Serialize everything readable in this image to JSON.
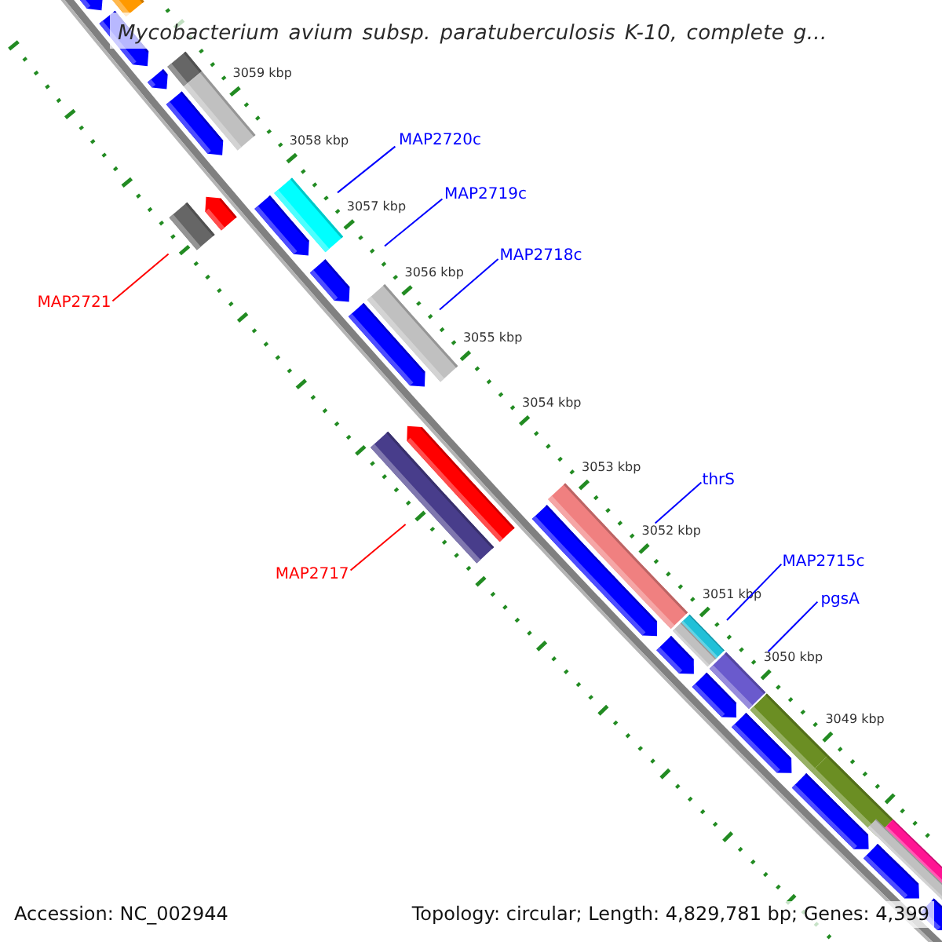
{
  "title": "Mycobacterium avium subsp. paratuberculosis K-10, complete g...",
  "ruler": {
    "tick_labels": [
      "3059 kbp",
      "3058 kbp",
      "3057 kbp",
      "3056 kbp",
      "3055 kbp",
      "3054 kbp",
      "3053 kbp",
      "3052 kbp",
      "3051 kbp",
      "3050 kbp",
      "3049 kbp"
    ]
  },
  "features": [
    {
      "kind": "arrow",
      "complement": true,
      "color": "#0000ff"
    },
    {
      "kind": "arrow",
      "complement": true,
      "color": "#0000ff"
    },
    {
      "kind": "arrow",
      "complement": true,
      "color": "#0000ff"
    },
    {
      "kind": "arrow",
      "complement": true,
      "color": "#0000ff"
    },
    {
      "kind": "arrow",
      "complement": true,
      "color": "#0000ff"
    },
    {
      "kind": "arrow",
      "complement": true,
      "color": "#0000ff"
    },
    {
      "kind": "arrow",
      "complement": true,
      "color": "#0000ff"
    },
    {
      "kind": "arrow",
      "complement": true,
      "color": "#0000ff"
    },
    {
      "kind": "arrow",
      "complement": true,
      "color": "#0000ff"
    },
    {
      "kind": "arrow",
      "complement": true,
      "color": "#0000ff"
    },
    {
      "kind": "arrow",
      "complement": true,
      "color": "#0000ff"
    },
    {
      "kind": "arrow",
      "complement": true,
      "color": "#0000ff"
    },
    {
      "kind": "arrow",
      "complement": true,
      "color": "#0000ff"
    },
    {
      "kind": "arrow",
      "complement": true,
      "color": "#0000ff"
    },
    {
      "kind": "block",
      "complement": true,
      "color": "#ff9900"
    },
    {
      "kind": "block",
      "complement": true,
      "color": "#666666"
    },
    {
      "kind": "block",
      "complement": true,
      "color": "#c0c0c0"
    },
    {
      "kind": "block",
      "complement": true,
      "color": "#00ffff"
    },
    {
      "kind": "block",
      "complement": true,
      "color": "#c0c0c0"
    },
    {
      "kind": "block",
      "complement": true,
      "color": "#f08080"
    },
    {
      "kind": "block",
      "complement": true,
      "color": "#20c0d8"
    },
    {
      "kind": "block",
      "complement": true,
      "color": "#c0c0c0"
    },
    {
      "kind": "block",
      "complement": true,
      "color": "#6a5acd"
    },
    {
      "kind": "block",
      "complement": true,
      "color": "#6b8e23"
    },
    {
      "kind": "block",
      "complement": true,
      "color": "#6b8e23"
    },
    {
      "kind": "block",
      "complement": true,
      "color": "#ff1493"
    },
    {
      "kind": "block",
      "complement": true,
      "color": "#c0c0c0"
    },
    {
      "kind": "arrow",
      "complement": false,
      "color": "#ff0000"
    },
    {
      "kind": "arrow",
      "complement": false,
      "color": "#ff0000"
    },
    {
      "kind": "block",
      "complement": false,
      "color": "#666666"
    },
    {
      "kind": "block",
      "complement": false,
      "color": "#483d8b"
    }
  ],
  "gene_labels": [
    {
      "text": "MAP2720c",
      "color": "#0000ff"
    },
    {
      "text": "MAP2719c",
      "color": "#0000ff"
    },
    {
      "text": "MAP2718c",
      "color": "#0000ff"
    },
    {
      "text": "MAP2721",
      "color": "#ff0000"
    },
    {
      "text": "MAP2717",
      "color": "#ff0000"
    },
    {
      "text": "thrS",
      "color": "#0000ff"
    },
    {
      "text": "MAP2715c",
      "color": "#0000ff"
    },
    {
      "text": "pgsA",
      "color": "#0000ff"
    }
  ],
  "footer": {
    "accession": "Accession: NC_002944",
    "summary": "Topology: circular; Length: 4,829,781 bp; Genes: 4,399"
  }
}
